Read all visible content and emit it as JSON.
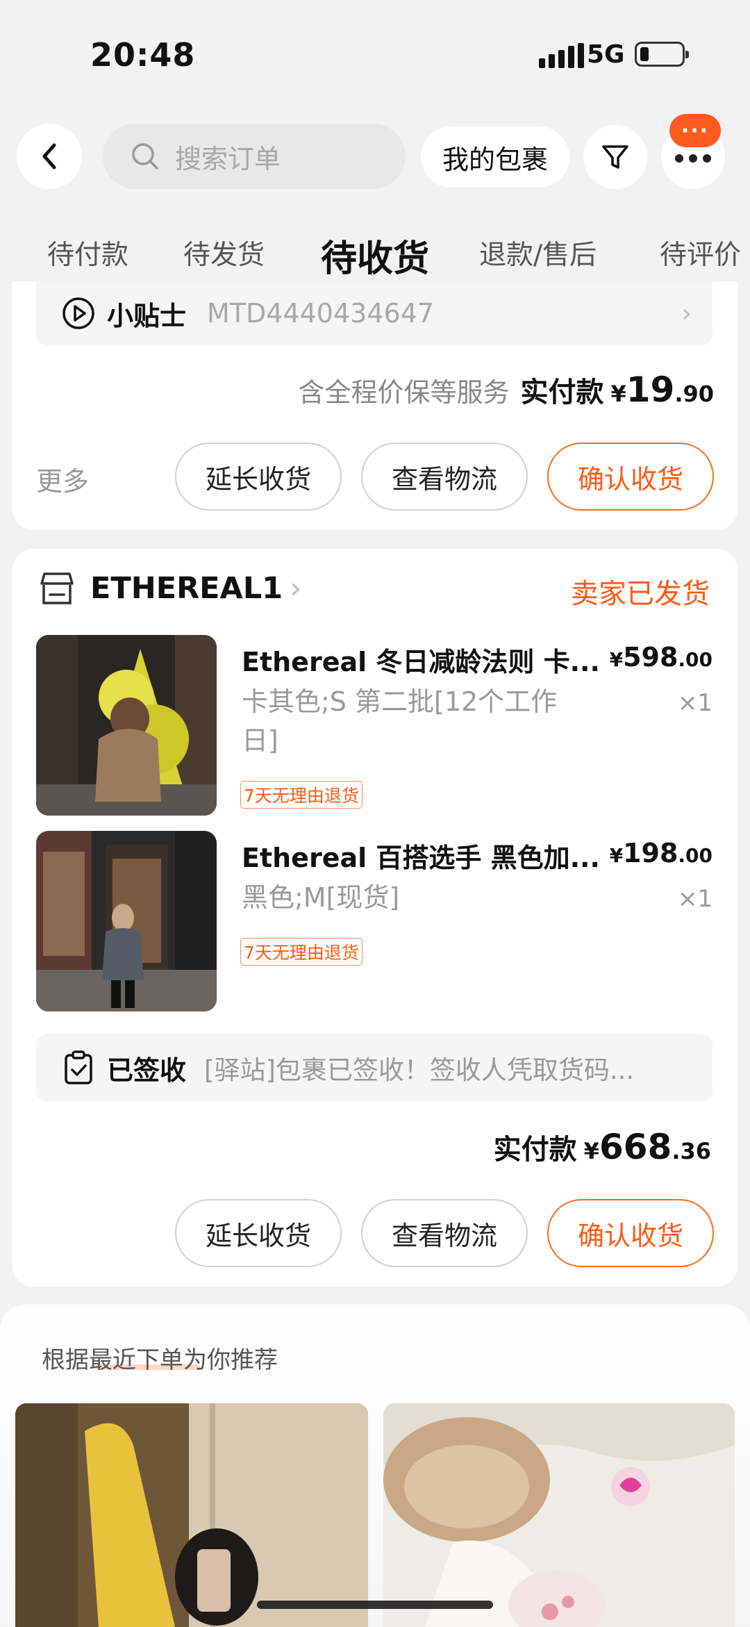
{
  "status_bar": {
    "time": "20:48",
    "network": "5G"
  },
  "header": {
    "search_placeholder": "搜索订单",
    "my_package_label": "我的包裹",
    "more_badge": "···"
  },
  "tabs": [
    "待付款",
    "待发货",
    "待收货",
    "退款/售后",
    "待评价"
  ],
  "active_tab": "待收货",
  "order1": {
    "tip_label": "小贴士",
    "tip_value": "MTD4440434647",
    "service_note": "含全程价保等服务",
    "paid_label": "实付款",
    "currency": "¥",
    "paid_int": "19",
    "paid_dec": ".90",
    "more_label": "更多",
    "actions": [
      "延长收货",
      "查看物流",
      "确认收货"
    ]
  },
  "order2": {
    "shop_name": "ETHEREAL1",
    "status": "卖家已发货",
    "products": [
      {
        "title": "Ethereal 冬日减龄法则 卡...",
        "sku": "卡其色;S 第二批[12个工作日]",
        "price_int": "598",
        "price_dec": ".00",
        "qty": "×1",
        "tag": "7天无理由退货"
      },
      {
        "title": "Ethereal 百搭选手 黑色加...",
        "sku": "黑色;M[现货]",
        "price_int": "198",
        "price_dec": ".00",
        "qty": "×1",
        "tag": "7天无理由退货"
      }
    ],
    "sign_label": "已签收",
    "sign_detail": "[驿站]包裹已签收！签收人凭取货码...",
    "paid_label": "实付款",
    "currency": "¥",
    "paid_int": "668",
    "paid_dec": ".36",
    "actions": [
      "延长收货",
      "查看物流",
      "确认收货"
    ]
  },
  "recommend": {
    "title": "根据最近下单为你推荐"
  },
  "colors": {
    "accent": "#ff5a12",
    "background": "#f2f2f2"
  }
}
